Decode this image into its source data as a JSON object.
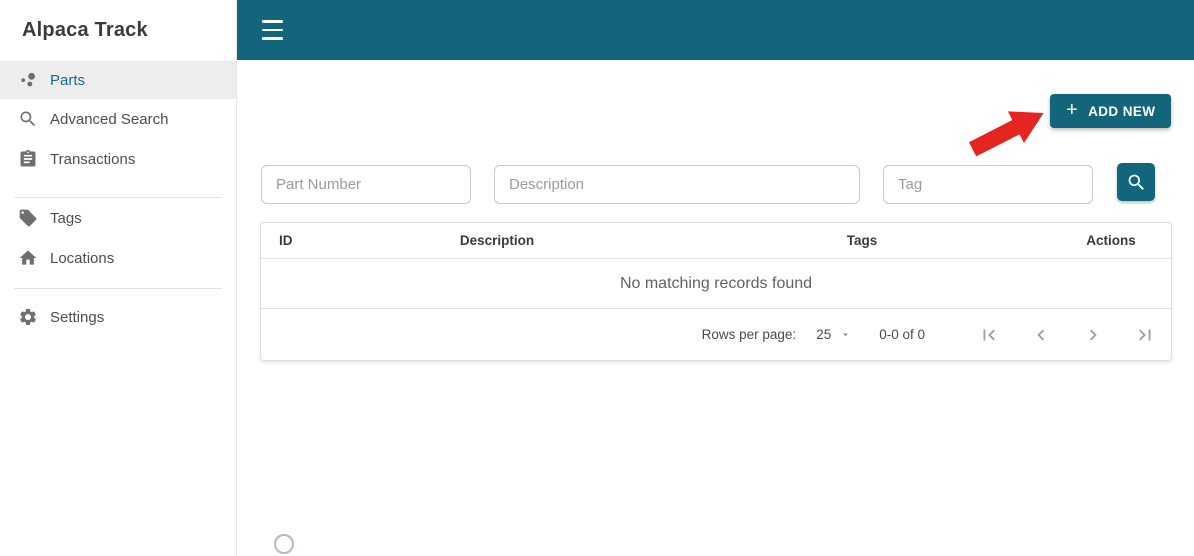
{
  "app": {
    "title": "Alpaca Track"
  },
  "colors": {
    "header_teal": "#12657a",
    "active_item_teal": "#1a6b7f",
    "annotation_arrow_red": "#e5251f",
    "active_item_bg": "#ededed"
  },
  "sidebar": {
    "items": [
      {
        "label": "Parts",
        "icon": "bubble-chart-icon",
        "active": true
      },
      {
        "label": "Advanced Search",
        "icon": "search-icon",
        "active": false
      },
      {
        "label": "Transactions",
        "icon": "clipboard-icon",
        "active": false
      },
      {
        "label": "Tags",
        "icon": "tag-icon",
        "active": false
      },
      {
        "label": "Locations",
        "icon": "home-icon",
        "active": false
      },
      {
        "label": "Settings",
        "icon": "gear-icon",
        "active": false
      }
    ]
  },
  "toolbar": {
    "add_new_label": "ADD NEW",
    "plus_glyph": "+"
  },
  "filters": {
    "part_number_placeholder": "Part Number",
    "description_placeholder": "Description",
    "tag_placeholder": "Tag"
  },
  "table": {
    "columns": [
      "ID",
      "Description",
      "Tags",
      "Actions"
    ],
    "rows": [],
    "empty_message": "No matching records found"
  },
  "pagination": {
    "rows_per_page_label": "Rows per page:",
    "rows_per_page_value": "25",
    "range_label": "0-0 of 0"
  }
}
